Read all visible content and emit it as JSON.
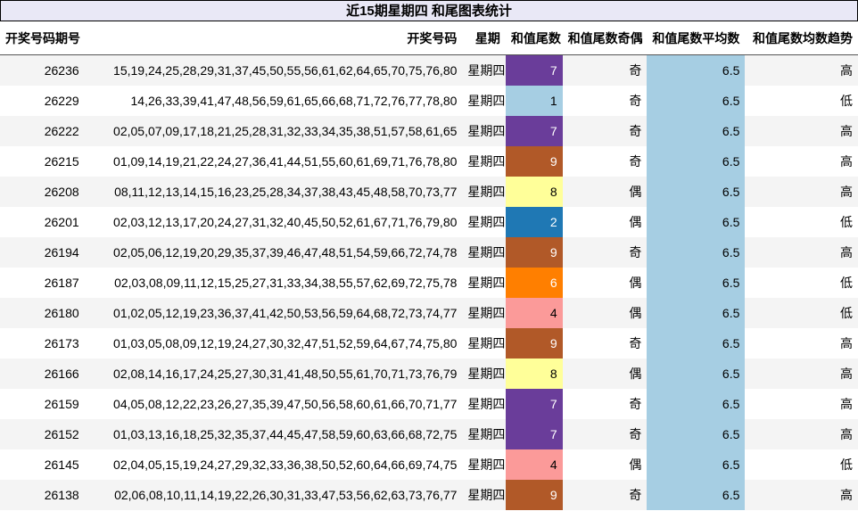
{
  "title": "近15期星期四 和尾图表统计",
  "headers": [
    "开奖号码期号",
    "开奖号码",
    "星期",
    "和值尾数",
    "和值尾数奇偶",
    "和值尾数平均数",
    "和值尾数均数趋势"
  ],
  "colors": {
    "0": "#ffffff",
    "1": "#a6cee3",
    "2": "#1f78b4",
    "3": "#b2df8a",
    "4": "#fb9a99",
    "5": "#e31a1c",
    "6": "#ff7f00",
    "7": "#6a3d9a",
    "8": "#ffff99",
    "9": "#b15928",
    "avg": "#a6cee3"
  },
  "rows": [
    {
      "issue": "26236",
      "nums": "15,19,24,25,28,29,31,37,45,50,55,56,61,62,64,65,70,75,76,80",
      "day": "星期四",
      "tail": "7",
      "oe": "奇",
      "avg": "6.5",
      "trend": "高"
    },
    {
      "issue": "26229",
      "nums": "14,26,33,39,41,47,48,56,59,61,65,66,68,71,72,76,77,78,80",
      "day": "星期四",
      "tail": "1",
      "oe": "奇",
      "avg": "6.5",
      "trend": "低"
    },
    {
      "issue": "26222",
      "nums": "02,05,07,09,17,18,21,25,28,31,32,33,34,35,38,51,57,58,61,65",
      "day": "星期四",
      "tail": "7",
      "oe": "奇",
      "avg": "6.5",
      "trend": "高"
    },
    {
      "issue": "26215",
      "nums": "01,09,14,19,21,22,24,27,36,41,44,51,55,60,61,69,71,76,78,80",
      "day": "星期四",
      "tail": "9",
      "oe": "奇",
      "avg": "6.5",
      "trend": "高"
    },
    {
      "issue": "26208",
      "nums": "08,11,12,13,14,15,16,23,25,28,34,37,38,43,45,48,58,70,73,77",
      "day": "星期四",
      "tail": "8",
      "oe": "偶",
      "avg": "6.5",
      "trend": "高"
    },
    {
      "issue": "26201",
      "nums": "02,03,12,13,17,20,24,27,31,32,40,45,50,52,61,67,71,76,79,80",
      "day": "星期四",
      "tail": "2",
      "oe": "偶",
      "avg": "6.5",
      "trend": "低"
    },
    {
      "issue": "26194",
      "nums": "02,05,06,12,19,20,29,35,37,39,46,47,48,51,54,59,66,72,74,78",
      "day": "星期四",
      "tail": "9",
      "oe": "奇",
      "avg": "6.5",
      "trend": "高"
    },
    {
      "issue": "26187",
      "nums": "02,03,08,09,11,12,15,25,27,31,33,34,38,55,57,62,69,72,75,78",
      "day": "星期四",
      "tail": "6",
      "oe": "偶",
      "avg": "6.5",
      "trend": "低"
    },
    {
      "issue": "26180",
      "nums": "01,02,05,12,19,23,36,37,41,42,50,53,56,59,64,68,72,73,74,77",
      "day": "星期四",
      "tail": "4",
      "oe": "偶",
      "avg": "6.5",
      "trend": "低"
    },
    {
      "issue": "26173",
      "nums": "01,03,05,08,09,12,19,24,27,30,32,47,51,52,59,64,67,74,75,80",
      "day": "星期四",
      "tail": "9",
      "oe": "奇",
      "avg": "6.5",
      "trend": "高"
    },
    {
      "issue": "26166",
      "nums": "02,08,14,16,17,24,25,27,30,31,41,48,50,55,61,70,71,73,76,79",
      "day": "星期四",
      "tail": "8",
      "oe": "偶",
      "avg": "6.5",
      "trend": "高"
    },
    {
      "issue": "26159",
      "nums": "04,05,08,12,22,23,26,27,35,39,47,50,56,58,60,61,66,70,71,77",
      "day": "星期四",
      "tail": "7",
      "oe": "奇",
      "avg": "6.5",
      "trend": "高"
    },
    {
      "issue": "26152",
      "nums": "01,03,13,16,18,25,32,35,37,44,45,47,58,59,60,63,66,68,72,75",
      "day": "星期四",
      "tail": "7",
      "oe": "奇",
      "avg": "6.5",
      "trend": "高"
    },
    {
      "issue": "26145",
      "nums": "02,04,05,15,19,24,27,29,32,33,36,38,50,52,60,64,66,69,74,75",
      "day": "星期四",
      "tail": "4",
      "oe": "偶",
      "avg": "6.5",
      "trend": "低"
    },
    {
      "issue": "26138",
      "nums": "02,06,08,10,11,14,19,22,26,30,31,33,47,53,56,62,63,73,76,77",
      "day": "星期四",
      "tail": "9",
      "oe": "奇",
      "avg": "6.5",
      "trend": "高"
    }
  ]
}
